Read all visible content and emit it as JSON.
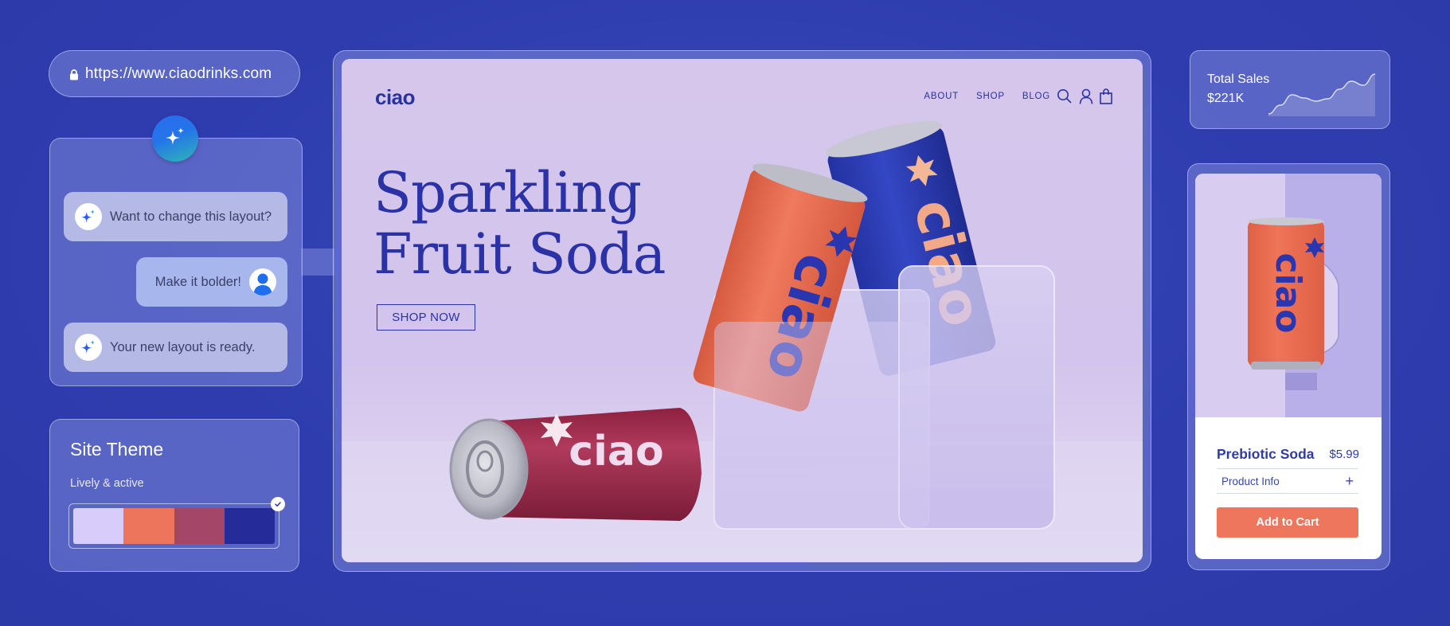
{
  "browser": {
    "url": "https://www.ciaodrinks.com",
    "lock_icon": "lock-icon"
  },
  "assistant": {
    "badge_icon": "sparkle-icon",
    "messages": [
      {
        "role": "assistant",
        "text": "Want to change this layout?",
        "icon": "sparkle-icon"
      },
      {
        "role": "user",
        "text": "Make it bolder!",
        "icon": "user-avatar-icon"
      },
      {
        "role": "assistant",
        "text": "Your new layout is ready.",
        "icon": "sparkle-icon"
      }
    ]
  },
  "theme": {
    "title": "Site Theme",
    "name": "Lively & active",
    "selected": true,
    "colors": [
      "#d8ccfa",
      "#ec755c",
      "#a34668",
      "#252b99"
    ]
  },
  "site": {
    "logo": "ciao",
    "nav": [
      "ABOUT",
      "SHOP",
      "BLOG"
    ],
    "nav_icons": [
      "search-icon",
      "account-icon",
      "shopping-bag-icon"
    ],
    "headline_line1": "Sparkling",
    "headline_line2": "Fruit Soda",
    "cta": "SHOP NOW",
    "can_brand": "ciao",
    "accent": "#2a32a6",
    "hero_bg": "#d6c6ec"
  },
  "sales": {
    "label": "Total Sales",
    "value": "$221K",
    "trend": [
      0,
      22,
      48,
      40,
      32,
      38,
      62,
      82,
      72,
      100
    ]
  },
  "product": {
    "name": "Prebiotic Soda",
    "price": "$5.99",
    "info_label": "Product Info",
    "info_toggle": "+",
    "cta": "Add to Cart",
    "cta_color": "#ee765c",
    "can_brand": "ciao"
  }
}
